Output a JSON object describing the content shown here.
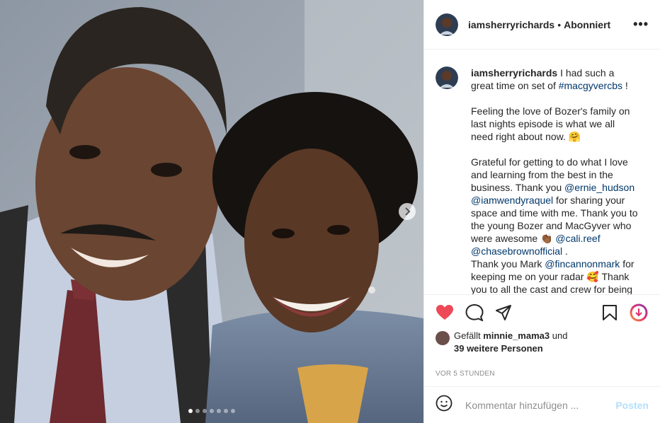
{
  "post": {
    "photo_alt": "Selfie of two smiling people",
    "carousel_dots": 7,
    "active_dot": 0
  },
  "header": {
    "username": "iamsherryrichards",
    "separator": "•",
    "follow_state": "Abonniert",
    "more_icon": "more-horizontal-icon"
  },
  "caption": {
    "username": "iamsherryrichards",
    "p1_text": " I had such a great time on set of ",
    "p1_tag": "#macgyvercbs",
    "p1_end": " !",
    "p2": "Feeling the love of Bozer's family on last nights episode is what we all need right about now. 🤗",
    "p3_a": "Grateful for getting to do what I love and learning from the best in the business. Thank you ",
    "p3_m1": "@ernie_hudson",
    "p3_m2": "@iamwendyraquel",
    "p3_b": " for sharing your space and time with me. Thank you to the young Bozer and MacGyver who were awesome 👏🏾 ",
    "p3_m3": "@cali.reef",
    "p3_m4": "@chasebrownofficial",
    "p3_c": " .",
    "p4_a": "Thank you Mark ",
    "p4_m1": "@fincannonmark",
    "p4_b": " for keeping me on your radar 🥰 Thank you to all the cast and crew for being so kind and making sure I was"
  },
  "actions": {
    "like_icon": "heart-filled-icon",
    "comment_icon": "comment-icon",
    "share_icon": "share-icon",
    "save_icon": "bookmark-icon",
    "extra_icon": "download-icon",
    "accent_like": "#ed4956"
  },
  "likes": {
    "prefix": "Gefällt ",
    "user": "minnie_mama3",
    "middle": " und",
    "others": "39 weitere Personen"
  },
  "time_ago": "VOR 5 STUNDEN",
  "comment": {
    "placeholder": "Kommentar hinzufügen ...",
    "post_label": "Posten"
  }
}
